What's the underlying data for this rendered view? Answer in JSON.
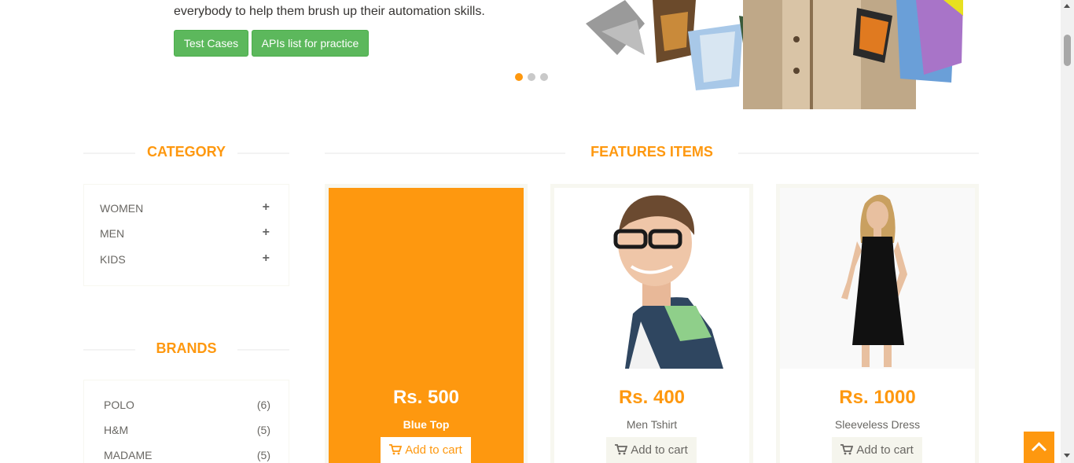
{
  "hero": {
    "text": "everybody to help them brush up their automation skills.",
    "test_cases": "Test Cases",
    "apis_list": "APIs list for practice"
  },
  "category": {
    "title": "CATEGORY",
    "items": [
      {
        "label": "WOMEN"
      },
      {
        "label": "MEN"
      },
      {
        "label": "KIDS"
      }
    ]
  },
  "brands": {
    "title": "BRANDS",
    "items": [
      {
        "label": "POLO",
        "count": "(6)"
      },
      {
        "label": "H&M",
        "count": "(5)"
      },
      {
        "label": "MADAME",
        "count": "(5)"
      }
    ]
  },
  "features": {
    "title": "FEATURES ITEMS",
    "products": [
      {
        "price": "Rs. 500",
        "name": "Blue Top",
        "cart": "Add to cart"
      },
      {
        "price": "Rs. 400",
        "name": "Men Tshirt",
        "cart": "Add to cart"
      },
      {
        "price": "Rs. 1000",
        "name": "Sleeveless Dress",
        "cart": "Add to cart"
      }
    ]
  },
  "colors": {
    "accent": "#fe980f",
    "button_green": "#5cb85c"
  }
}
